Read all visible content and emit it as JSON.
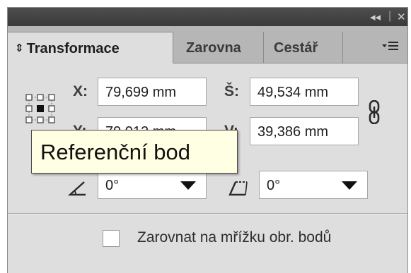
{
  "panel": {
    "collapse_icon": "double-chevron-left-icon",
    "close_icon": "close-icon"
  },
  "tabs": [
    {
      "label": "Transformace",
      "active": true,
      "icon": "up-down-arrows-icon"
    },
    {
      "label": "Zarovna",
      "active": false
    },
    {
      "label": "Cestář",
      "active": false
    }
  ],
  "menu_icon": "panel-menu-icon",
  "fields": {
    "x": {
      "label": "X:",
      "value": "79,699 mm"
    },
    "y": {
      "label": "Y:",
      "value": "79,012 mm"
    },
    "width": {
      "label": "Š:",
      "value": "49,534 mm"
    },
    "height": {
      "label": "V:",
      "value": "39,386 mm"
    },
    "rotate": {
      "value": "0°",
      "icon": "rotate-angle-icon"
    },
    "shear": {
      "value": "0°",
      "icon": "shear-angle-icon"
    }
  },
  "reference_point_icon": "reference-point-icon",
  "link_icon": "constrain-proportions-link-icon",
  "checkbox": {
    "label": "Zarovnat na mřížku obr. bodů",
    "checked": false
  },
  "tooltip": {
    "text": "Referenční bod"
  }
}
